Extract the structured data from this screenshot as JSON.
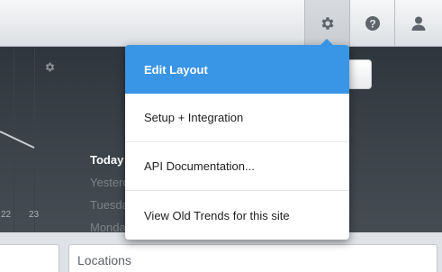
{
  "topbar": {
    "buttons": [
      {
        "icon": "gear-icon",
        "active": true
      },
      {
        "icon": "help-icon"
      },
      {
        "icon": "user-icon"
      }
    ]
  },
  "chart": {
    "tick_labels": [
      "22",
      "23"
    ]
  },
  "day_list": [
    "Today",
    "Yesterday",
    "Tuesday",
    "Monday"
  ],
  "bottom": {
    "locations_title": "Locations"
  },
  "settings_menu": {
    "items": [
      {
        "label": "Edit Layout",
        "active": true
      },
      {
        "label": "Setup + Integration"
      },
      {
        "label": "API Documentation..."
      },
      {
        "label": "View Old Trends for this site"
      }
    ]
  },
  "colors": {
    "menu_accent": "#3995e5",
    "dashboard_bg": "#353c43"
  }
}
